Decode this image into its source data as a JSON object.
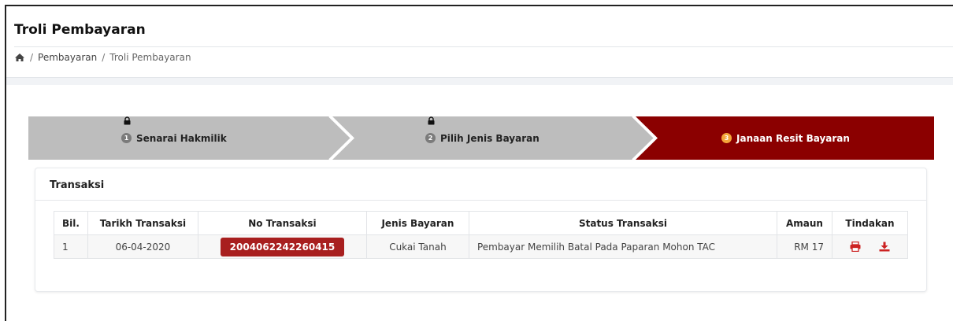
{
  "header": {
    "title": "Troli Pembayaran",
    "breadcrumb": {
      "home_icon": "home-icon",
      "separator": "/",
      "items": [
        "Pembayaran",
        "Troli Pembayaran"
      ]
    }
  },
  "steps": [
    {
      "number": "1",
      "label": "Senarai Hakmilik",
      "locked": true,
      "state": "inactive"
    },
    {
      "number": "2",
      "label": "Pilih Jenis Bayaran",
      "locked": true,
      "state": "inactive"
    },
    {
      "number": "3",
      "label": "Janaan Resit Bayaran",
      "locked": false,
      "state": "active"
    }
  ],
  "colors": {
    "active_step": "#8b0000",
    "inactive_step": "#bdbdbd",
    "badge": "#a81f1f",
    "number_badge_active": "#f4a63a",
    "action_icons": "#cc2222"
  },
  "card": {
    "title": "Transaksi",
    "columns": [
      "Bil.",
      "Tarikh Transaksi",
      "No Transaksi",
      "Jenis Bayaran",
      "Status Transaksi",
      "Amaun",
      "Tindakan"
    ],
    "rows": [
      {
        "bil": "1",
        "tarikh": "06-04-2020",
        "no": "2004062242260415",
        "jenis": "Cukai Tanah",
        "status": "Pembayar Memilih Batal Pada Paparan Mohon TAC",
        "amaun": "RM 17",
        "actions": [
          "print-icon",
          "download-icon"
        ]
      }
    ]
  }
}
